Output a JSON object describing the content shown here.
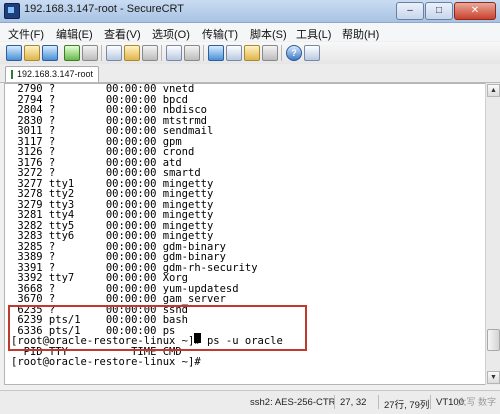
{
  "window": {
    "title": "192.168.3.147-root - SecureCRT",
    "controls": {
      "minimize": "–",
      "maximize": "□",
      "close": "✕"
    }
  },
  "menu": {
    "items": [
      {
        "label": "文件(F)"
      },
      {
        "label": "编辑(E)"
      },
      {
        "label": "查看(V)"
      },
      {
        "label": "选项(O)"
      },
      {
        "label": "传输(T)"
      },
      {
        "label": "脚本(S)"
      },
      {
        "label": "工具(L)"
      },
      {
        "label": "帮助(H)"
      }
    ]
  },
  "toolbar": {
    "buttons": [
      {
        "icon": "connect-icon"
      },
      {
        "icon": "quick-connect-icon"
      },
      {
        "icon": "connect-in-tab-icon"
      },
      {
        "icon": "reconnect-icon"
      },
      {
        "icon": "disconnect-icon"
      },
      {
        "icon": "copy-icon"
      },
      {
        "icon": "paste-icon"
      },
      {
        "icon": "find-icon"
      },
      {
        "icon": "print-icon"
      },
      {
        "icon": "print-setup-icon"
      },
      {
        "icon": "session-options-icon"
      },
      {
        "icon": "global-options-icon"
      },
      {
        "icon": "sftp-icon"
      },
      {
        "icon": "keymap-icon"
      },
      {
        "icon": "help-icon"
      },
      {
        "icon": "properties-icon"
      }
    ]
  },
  "tabs": [
    {
      "label": "192.168.3.147-root",
      "active": true
    }
  ],
  "terminal": {
    "lines": [
      " 2790 ?        00:00:00 vnetd",
      " 2794 ?        00:00:00 bpcd",
      " 2804 ?        00:00:00 nbdisco",
      " 2830 ?        00:00:00 mtstrmd",
      " 3011 ?        00:00:00 sendmail",
      " 3117 ?        00:00:00 gpm",
      " 3126 ?        00:00:00 crond",
      " 3176 ?        00:00:00 atd",
      " 3272 ?        00:00:00 smartd",
      " 3277 tty1     00:00:00 mingetty",
      " 3278 tty2     00:00:00 mingetty",
      " 3279 tty3     00:00:00 mingetty",
      " 3281 tty4     00:00:00 mingetty",
      " 3282 tty5     00:00:00 mingetty",
      " 3283 tty6     00:00:00 mingetty",
      " 3285 ?        00:00:00 gdm-binary",
      " 3389 ?        00:00:00 gdm-binary",
      " 3391 ?        00:00:00 gdm-rh-security",
      " 3392 tty7     00:00:00 Xorg",
      " 3668 ?        00:00:00 yum-updatesd",
      " 3670 ?        00:00:00 gam_server",
      " 6235 ?        00:00:00 sshd",
      " 6239 pts/1    00:00:00 bash",
      " 6336 pts/1    00:00:00 ps",
      "[root@oracle-restore-linux ~]# ps -u oracle",
      "  PID TTY          TIME CMD",
      "[root@oracle-restore-linux ~]# "
    ]
  },
  "scrollbar": {
    "position": 0.92,
    "visible_fraction": 0.08
  },
  "status": {
    "protocol": "ssh2: AES-256-CTR",
    "cursor_pos": "27,  32",
    "rows_cols": "27行, 79列",
    "terminal_type": "VT100",
    "watermark": "大写  数字"
  },
  "colors": {
    "highlight_box": "#c0392b",
    "terminal_background": "#ffffff",
    "terminal_text": "#000000"
  }
}
